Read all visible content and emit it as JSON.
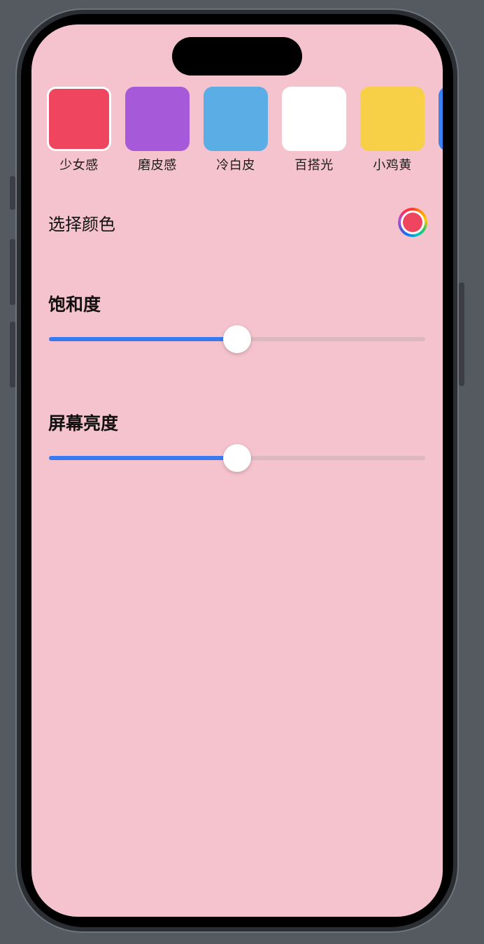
{
  "presets": [
    {
      "label": "少女感",
      "color": "#ef455e",
      "selected": true
    },
    {
      "label": "磨皮感",
      "color": "#a65ad9",
      "selected": false
    },
    {
      "label": "冷白皮",
      "color": "#5baee5",
      "selected": false
    },
    {
      "label": "百搭光",
      "color": "#ffffff",
      "selected": false
    },
    {
      "label": "小鸡黄",
      "color": "#f8d048",
      "selected": false
    },
    {
      "label": "",
      "color": "#3a82f0",
      "selected": false
    }
  ],
  "color_picker": {
    "label": "选择颜色",
    "current_color": "#ef455e",
    "icon": "color-wheel-icon"
  },
  "saturation": {
    "title": "饱和度",
    "value": 0.5
  },
  "brightness": {
    "title": "屏幕亮度",
    "value": 0.5
  },
  "theme": {
    "background": "#f5c3cd",
    "accent": "#3a7af0"
  }
}
